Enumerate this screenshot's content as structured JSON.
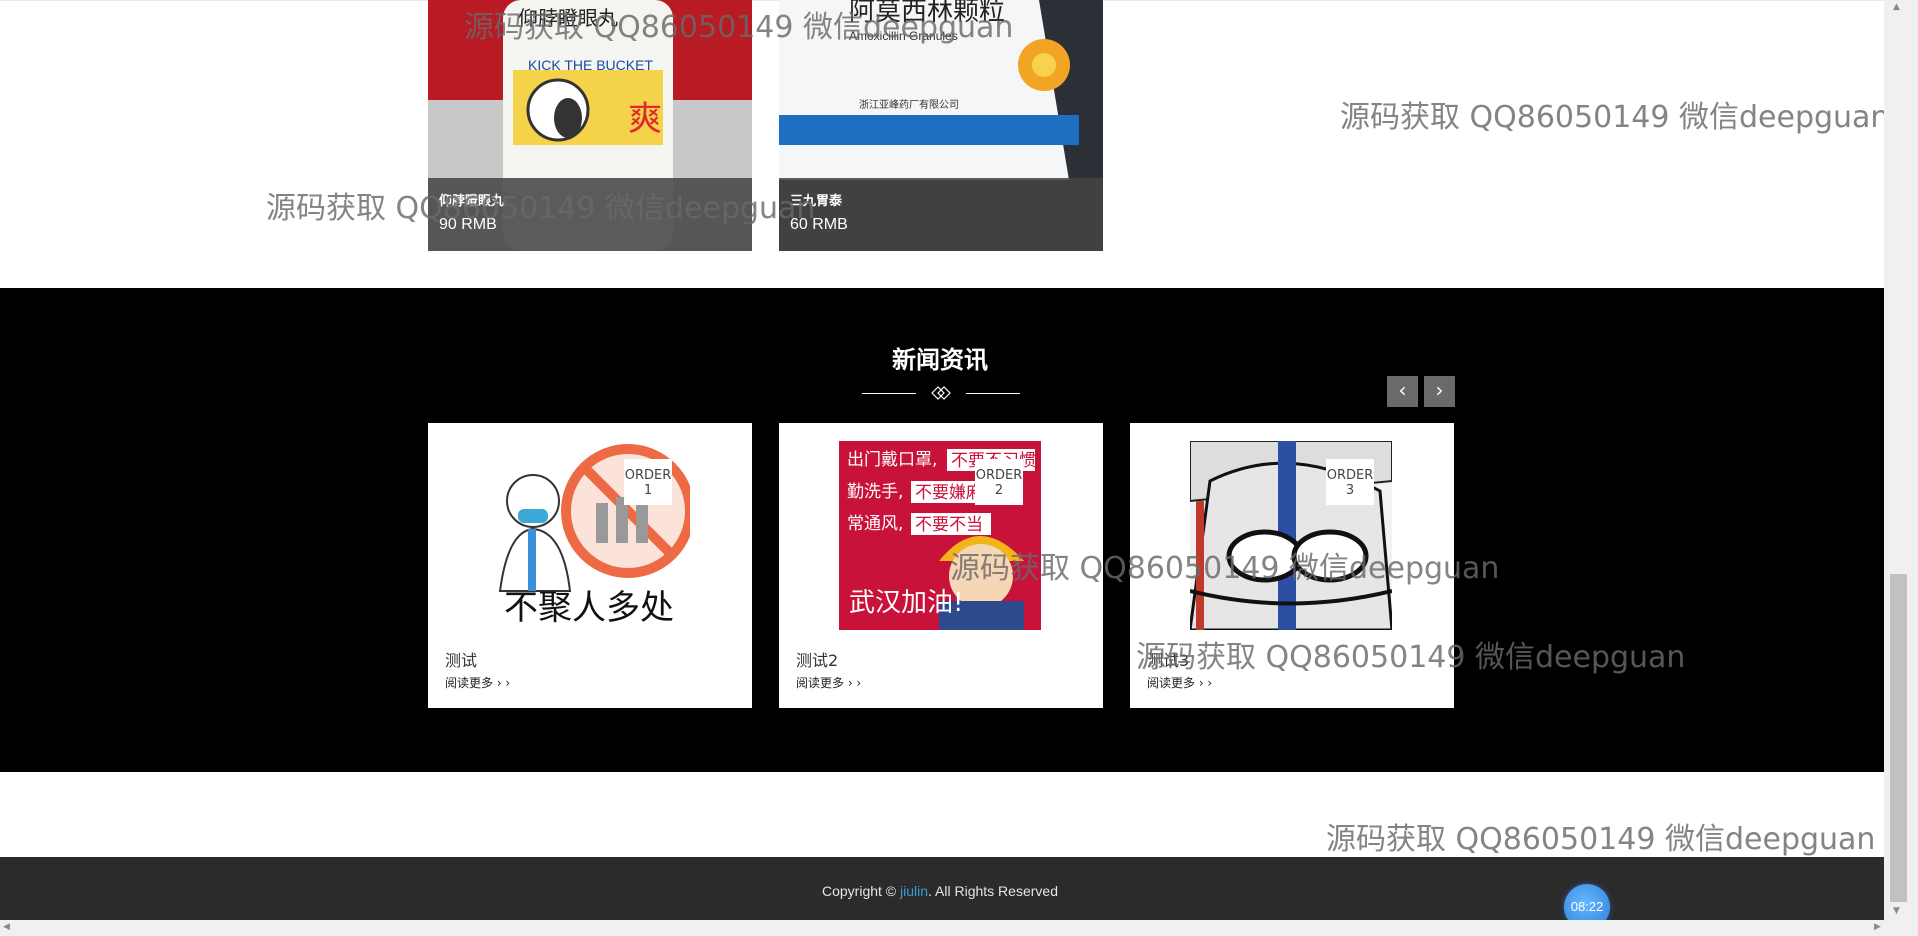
{
  "products": [
    {
      "name": "仰脖瞪眼丸",
      "price": "90 RMB",
      "image": "pill-bottle-kick-the-bucket"
    },
    {
      "name": "三九胃泰",
      "price": "60 RMB",
      "image": "amoxicillin-granules-box"
    }
  ],
  "news": {
    "title": "新闻资讯",
    "prev_label": "‹",
    "next_label": "›",
    "items": [
      {
        "title": "测试",
        "order": "ORDER\n1",
        "read_more": "阅读更多 › ›",
        "image": "no-gathering-cartoon"
      },
      {
        "title": "测试2",
        "order": "ORDER\n2",
        "read_more": "阅读更多 › ›",
        "image": "wear-mask-poster"
      },
      {
        "title": "测试3",
        "order": "ORDER\n3",
        "read_more": "阅读更多 › ›",
        "image": "medical-worker-sketch"
      }
    ]
  },
  "footer": {
    "copyright_prefix": "Copyright © ",
    "brand": "jiulin",
    "copyright_suffix": ". All Rights Reserved"
  },
  "clock": "08:22",
  "watermark": "源码获取 QQ86050149 微信deepguan",
  "colors": {
    "news_bg": "#000000",
    "footer_bg": "#2b2b2b",
    "link": "#3e9ad8",
    "caption_bg": "#464646"
  }
}
